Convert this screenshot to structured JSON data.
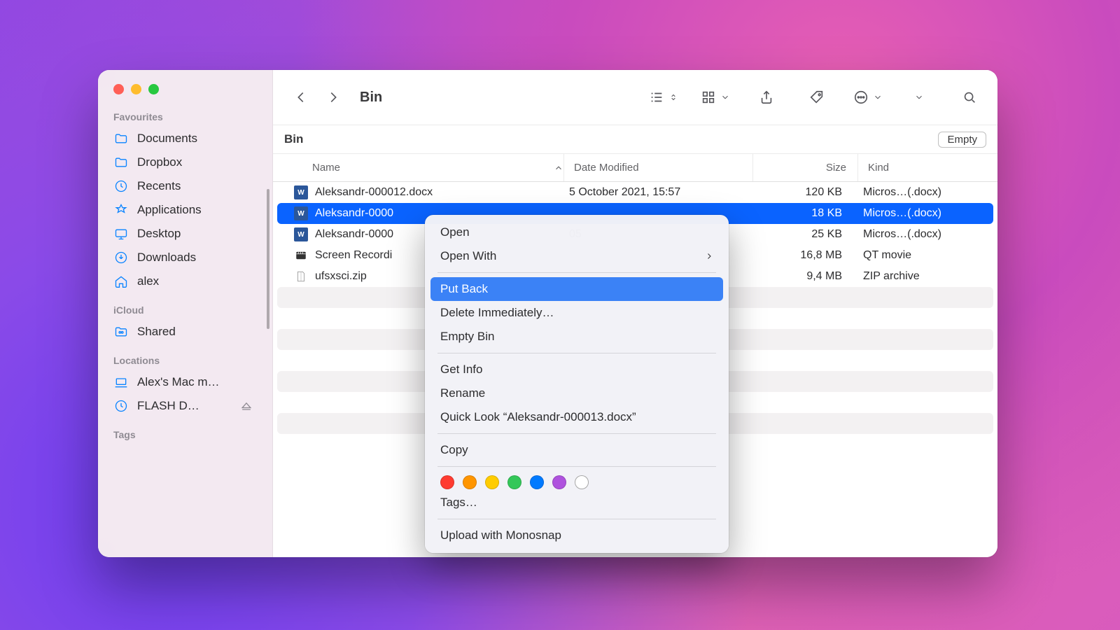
{
  "window": {
    "title": "Bin"
  },
  "sidebar": {
    "sections": [
      {
        "heading": "Favourites",
        "items": [
          {
            "label": "Documents"
          },
          {
            "label": "Dropbox"
          },
          {
            "label": "Recents"
          },
          {
            "label": "Applications"
          },
          {
            "label": "Desktop"
          },
          {
            "label": "Downloads"
          },
          {
            "label": "alex"
          }
        ]
      },
      {
        "heading": "iCloud",
        "items": [
          {
            "label": "Shared"
          }
        ]
      },
      {
        "heading": "Locations",
        "items": [
          {
            "label": "Alex's Mac m…"
          },
          {
            "label": "FLASH D…"
          }
        ]
      },
      {
        "heading": "Tags",
        "items": []
      }
    ]
  },
  "pathbar": {
    "crumb": "Bin",
    "empty": "Empty"
  },
  "columns": {
    "name": "Name",
    "date": "Date Modified",
    "size": "Size",
    "kind": "Kind"
  },
  "files": [
    {
      "name": "Aleksandr-000012.docx",
      "date": "5 October 2021, 15:57",
      "size": "120 KB",
      "kind": "Micros…(.docx)",
      "icon": "word"
    },
    {
      "name": "Aleksandr-0000",
      "date": "",
      "size": "18 KB",
      "kind": "Micros…(.docx)",
      "icon": "word",
      "selected": true
    },
    {
      "name": "Aleksandr-0000",
      "date": "05",
      "size": "25 KB",
      "kind": "Micros…(.docx)",
      "icon": "word"
    },
    {
      "name": "Screen Recordi",
      "date": "",
      "size": "16,8 MB",
      "kind": "QT movie",
      "icon": "mov"
    },
    {
      "name": "ufsxsci.zip",
      "date": "",
      "size": "9,4 MB",
      "kind": "ZIP archive",
      "icon": "zip"
    }
  ],
  "menu": {
    "open": "Open",
    "open_with": "Open With",
    "put_back": "Put Back",
    "delete_now": "Delete Immediately…",
    "empty_bin": "Empty Bin",
    "get_info": "Get Info",
    "rename": "Rename",
    "quick_look": "Quick Look “Aleksandr-000013.docx”",
    "copy": "Copy",
    "tags": "Tags…",
    "upload": "Upload with Monosnap",
    "tag_colors": [
      "#ff3b30",
      "#ff9500",
      "#ffcc00",
      "#34c759",
      "#007aff",
      "#af52de",
      "#ffffff"
    ]
  }
}
